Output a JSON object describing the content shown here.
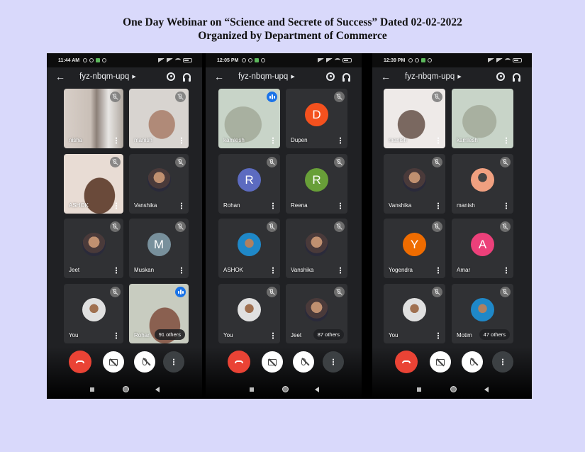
{
  "heading": {
    "line1": "One Day Webinar on “Science and Secrete of Success”  Dated 02-02-2022",
    "line2": "Organized by Department of Commerce"
  },
  "phones": [
    {
      "status_time": "11:44 AM",
      "meeting_code": "fyz-nbqm-upq",
      "tiles": [
        {
          "name": "nisha",
          "type": "video",
          "state": "muted"
        },
        {
          "name": "manish",
          "type": "video",
          "state": "muted"
        },
        {
          "name": "ASHOK",
          "type": "video",
          "state": "muted"
        },
        {
          "name": "Vanshika",
          "type": "photo",
          "state": "muted"
        },
        {
          "name": "Jeet",
          "type": "photo",
          "state": "muted"
        },
        {
          "name": "Muskan",
          "type": "initial",
          "initial": "M",
          "color": "#78909c",
          "state": "muted"
        },
        {
          "name": "You",
          "type": "photo",
          "state": "muted"
        },
        {
          "name": "Rohan",
          "type": "video",
          "state": "speaking",
          "others": "91 others"
        }
      ]
    },
    {
      "status_time": "12:05 PM",
      "meeting_code": "fyz-nbqm-upq",
      "tiles": [
        {
          "name": "kamlesh",
          "type": "video",
          "state": "speaking"
        },
        {
          "name": "Dupen",
          "type": "initial",
          "initial": "D",
          "color": "#f4511e",
          "state": "muted"
        },
        {
          "name": "Rohan",
          "type": "initial",
          "initial": "R",
          "color": "#5c6bc0",
          "state": "muted"
        },
        {
          "name": "Reena",
          "type": "initial",
          "initial": "R",
          "color": "#689f38",
          "state": "muted"
        },
        {
          "name": "ASHOK",
          "type": "photo",
          "state": "muted"
        },
        {
          "name": "Vanshika",
          "type": "photo",
          "state": "muted"
        },
        {
          "name": "You",
          "type": "photo",
          "state": "muted"
        },
        {
          "name": "Jeet",
          "type": "photo",
          "state": "muted",
          "others": "87 others"
        }
      ]
    },
    {
      "status_time": "12:39 PM",
      "meeting_code": "fyz-nbqm-upq",
      "tiles": [
        {
          "name": "manish",
          "type": "video",
          "state": "muted"
        },
        {
          "name": "kamlesh",
          "type": "video",
          "state": "none"
        },
        {
          "name": "Vanshika",
          "type": "photo",
          "state": "muted"
        },
        {
          "name": "manish",
          "type": "photo",
          "state": "muted"
        },
        {
          "name": "Yogendra",
          "type": "initial",
          "initial": "Y",
          "color": "#ef6c00",
          "state": "muted"
        },
        {
          "name": "Amar",
          "type": "initial",
          "initial": "A",
          "color": "#ec407a",
          "state": "muted"
        },
        {
          "name": "You",
          "type": "photo",
          "state": "muted"
        },
        {
          "name": "Motim",
          "type": "photo",
          "state": "muted",
          "others": "47 others"
        }
      ]
    }
  ],
  "icons": {
    "back": "arrow-left-icon",
    "switch_camera": "switch-camera-icon",
    "audio_output": "headset-icon",
    "end_call": "end-call-icon",
    "camera_off": "camera-off-icon",
    "mic_off": "mic-off-icon",
    "more": "more-vert-icon"
  },
  "colors": {
    "page_bg": "#d9d9fb",
    "end_call": "#ea4335",
    "speaking": "#1a73e8",
    "tile_bg": "#303134"
  }
}
